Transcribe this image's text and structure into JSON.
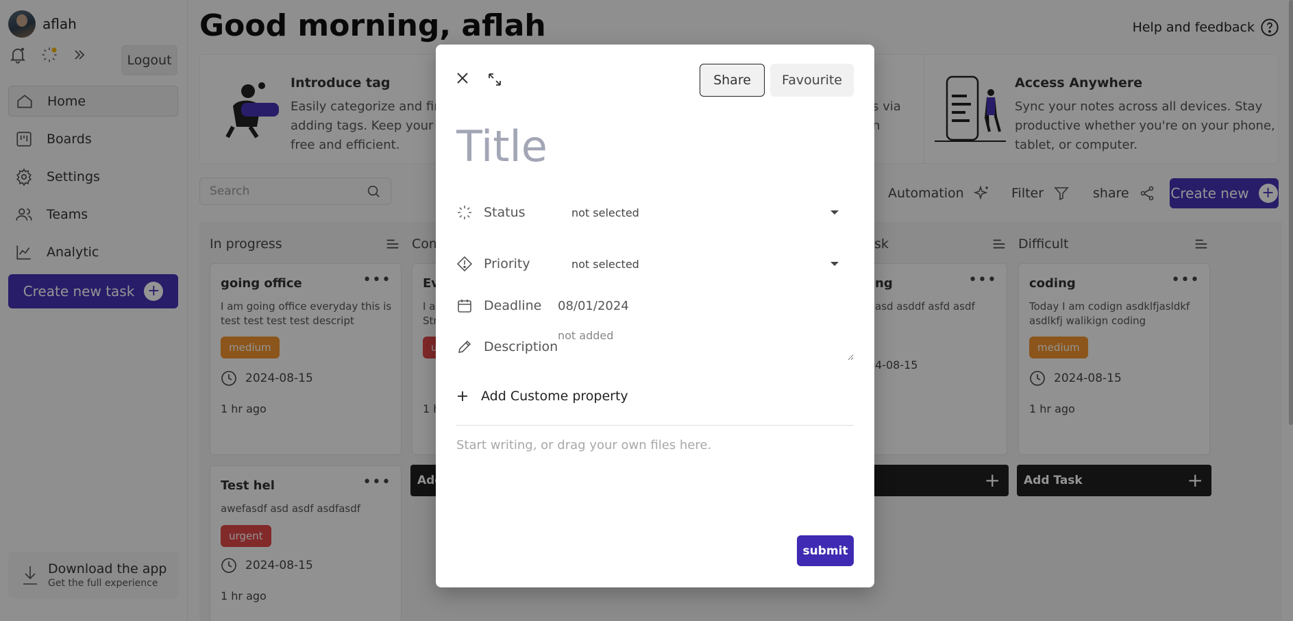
{
  "user": {
    "name": "aflah"
  },
  "sidebar": {
    "logout_label": "Logout",
    "items": [
      {
        "label": "Home",
        "icon": "home-icon",
        "active": true
      },
      {
        "label": "Boards",
        "icon": "boards-icon"
      },
      {
        "label": "Settings",
        "icon": "gear-icon"
      },
      {
        "label": "Teams",
        "icon": "users-icon"
      },
      {
        "label": "Analytic",
        "icon": "chart-icon"
      }
    ],
    "create_task_label": "Create new task",
    "download": {
      "title": "Download the app",
      "subtitle": "Get the full experience"
    }
  },
  "header": {
    "greeting": "Good morning, aflah",
    "help_label": "Help and feedback"
  },
  "features": [
    {
      "title": "Introduce tag",
      "desc_lines": [
        "Easily categorize and find",
        "adding tags. Keep your wo",
        "free and efficient."
      ]
    },
    {
      "title": "",
      "desc_lines": [
        "s via",
        "n"
      ]
    },
    {
      "title": "Access Anywhere",
      "desc_lines": [
        "Sync your notes across all devices. Stay",
        "productive whether you're on your phone,",
        "tablet, or computer."
      ]
    }
  ],
  "toolbar": {
    "search_placeholder": "Search",
    "automation_label": "Automation",
    "filter_label": "Filter",
    "share_label": "share",
    "create_new_label": "Create new"
  },
  "columns": [
    {
      "title": "In progress"
    },
    {
      "title": "Com"
    },
    {
      "title": "sk"
    },
    {
      "title": "Difficult"
    }
  ],
  "cards": {
    "c1": {
      "title": "going office",
      "desc": "I am going office everyday this is test test test test descript",
      "tag": "medium",
      "date": "2024-08-15",
      "ago": "1 hr ago"
    },
    "c2": {
      "title": "Ev",
      "desc_l1": "I a",
      "desc_l2": "Str",
      "tag": "u",
      "ago": "1 h"
    },
    "c3": {
      "title": "ng",
      "desc": "asd asddf asfd asdf",
      "date": "4-08-15"
    },
    "c4": {
      "title": "coding",
      "desc": "Today I am codign asdklfjasldkf asdlkfj walikign coding",
      "tag": "medium",
      "date": "2024-08-15",
      "ago": "1 hr ago"
    },
    "c5": {
      "title": "Test hel",
      "desc": "awefasdf asd asdf asdfasdf",
      "tag": "urgent",
      "date": "2024-08-15",
      "ago": "1 hr ago"
    }
  },
  "add_task": {
    "label": "Add Task",
    "partial_label": "Add"
  },
  "modal": {
    "share_label": "Share",
    "favourite_label": "Favourite",
    "title_placeholder": "Title",
    "status": {
      "label": "Status",
      "value": "not selected"
    },
    "priority": {
      "label": "Priority",
      "value": "not selected"
    },
    "deadline": {
      "label": "Deadline",
      "value": "08/01/2024"
    },
    "description": {
      "label": "Description",
      "placeholder": "not added"
    },
    "add_property_label": "Add Custome property",
    "body_placeholder": "Start writing, or drag your own files here.",
    "submit_label": "submit"
  },
  "colors": {
    "accent": "#4632b6",
    "medium": "#f0932f",
    "urgent": "#e04747",
    "dark_button": "#1f1f1f"
  }
}
